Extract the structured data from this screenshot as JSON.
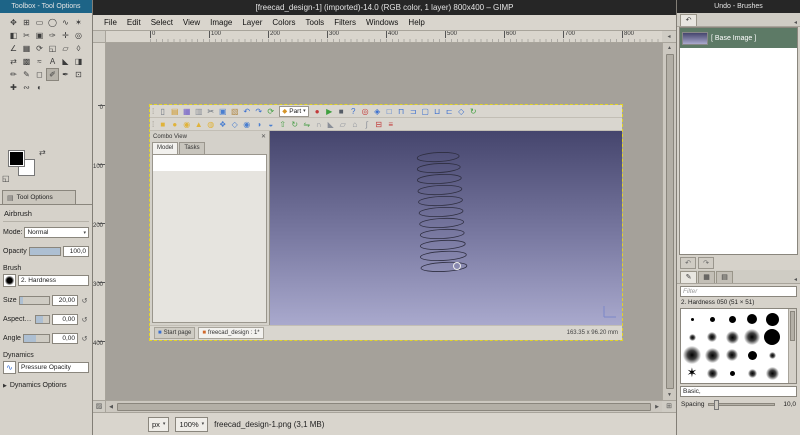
{
  "windows": {
    "toolbox_title": "Toolbox - Tool Options",
    "main_title": "[freecad_design-1] (imported)-14.0 (RGB color, 1 layer) 800x400 – GIMP",
    "dock_title": "Undo - Brushes"
  },
  "menubar": [
    "File",
    "Edit",
    "Select",
    "View",
    "Image",
    "Layer",
    "Colors",
    "Tools",
    "Filters",
    "Windows",
    "Help"
  ],
  "rulers": {
    "horizontal": [
      "0",
      "100",
      "200",
      "300",
      "400",
      "500",
      "600",
      "700",
      "800"
    ],
    "vertical": [
      "0",
      "100",
      "200",
      "300",
      "400"
    ]
  },
  "colors": {
    "focused_titlebar": "#1d6487",
    "titlebar": "#262626",
    "undo_selection": "#5d7a66",
    "viewport_gradient_top": "#45456d",
    "viewport_gradient_bottom": "#a9a9cd",
    "layer_boundary": "#e3d424"
  },
  "toolbox": {
    "tab_label": "Tool Options",
    "foreground_color": "#000000",
    "background_color": "#ffffff",
    "tools": [
      {
        "name": "move-tool",
        "glyph": "✥"
      },
      {
        "name": "alignment-tool",
        "glyph": "⊞"
      },
      {
        "name": "rectangle-select-tool",
        "glyph": "▭"
      },
      {
        "name": "ellipse-select-tool",
        "glyph": "◯"
      },
      {
        "name": "free-select-tool",
        "glyph": "∿"
      },
      {
        "name": "fuzzy-select-tool",
        "glyph": "✶"
      },
      {
        "name": "select-by-color-tool",
        "glyph": "◧"
      },
      {
        "name": "scissors-select-tool",
        "glyph": "✂"
      },
      {
        "name": "foreground-select-tool",
        "glyph": "▣"
      },
      {
        "name": "paths-tool",
        "glyph": "✑"
      },
      {
        "name": "color-picker-tool",
        "glyph": "✛"
      },
      {
        "name": "zoom-tool",
        "glyph": "◎"
      },
      {
        "name": "measure-tool",
        "glyph": "∠"
      },
      {
        "name": "crop-tool",
        "glyph": "▦"
      },
      {
        "name": "rotate-tool",
        "glyph": "⟳"
      },
      {
        "name": "scale-tool",
        "glyph": "◱"
      },
      {
        "name": "shear-tool",
        "glyph": "▱"
      },
      {
        "name": "perspective-tool",
        "glyph": "◊"
      },
      {
        "name": "flip-tool",
        "glyph": "⇄"
      },
      {
        "name": "cage-transform-tool",
        "glyph": "▩"
      },
      {
        "name": "warp-transform-tool",
        "glyph": "≈"
      },
      {
        "name": "text-tool",
        "glyph": "A"
      },
      {
        "name": "bucket-fill-tool",
        "glyph": "◣"
      },
      {
        "name": "gradient-tool",
        "glyph": "◨"
      },
      {
        "name": "pencil-tool",
        "glyph": "✏"
      },
      {
        "name": "paintbrush-tool",
        "glyph": "✎"
      },
      {
        "name": "eraser-tool",
        "glyph": "◻"
      },
      {
        "name": "airbrush-tool",
        "glyph": "✐",
        "state": "selected"
      },
      {
        "name": "ink-tool",
        "glyph": "✒"
      },
      {
        "name": "clone-tool",
        "glyph": "⊡"
      },
      {
        "name": "heal-tool",
        "glyph": "✚"
      },
      {
        "name": "smudge-tool",
        "glyph": "∾"
      },
      {
        "name": "dodge-burn-tool",
        "glyph": "◐"
      }
    ]
  },
  "tool_options": {
    "tool_name": "Airbrush",
    "mode_label": "Mode:",
    "mode_value": "Normal",
    "opacity_label": "Opacity",
    "opacity_value": "100,0",
    "brush_label": "Brush",
    "brush_name": "2. Hardness",
    "size_label": "Size",
    "size_value": "20,00",
    "aspect_label": "Aspect Ratio",
    "aspect_value": "0,00",
    "angle_label": "Angle",
    "angle_value": "0,00",
    "dynamics_label": "Dynamics",
    "dynamics_value": "Pressure Opacity",
    "dynamics_options_label": "Dynamics Options"
  },
  "statusbar": {
    "unit": "px",
    "zoom": "100%",
    "message": "freecad_design-1.png (3,1 MB)"
  },
  "freecad": {
    "workbench_label": "Part",
    "toolbar1a": [
      {
        "name": "file-new-icon",
        "glyph": "▯",
        "color": "#6a737f"
      },
      {
        "name": "file-open-icon",
        "glyph": "▤",
        "color": "#cf9a2f"
      },
      {
        "name": "file-save-icon",
        "glyph": "▦",
        "color": "#6f5bc9"
      },
      {
        "name": "print-icon",
        "glyph": "▥",
        "color": "#8a8f98"
      },
      {
        "name": "cut-icon",
        "glyph": "✂",
        "color": "#5a6472"
      },
      {
        "name": "copy-icon",
        "glyph": "▣",
        "color": "#4a7fd0"
      },
      {
        "name": "paste-icon",
        "glyph": "▧",
        "color": "#b08a4a"
      },
      {
        "name": "undo-icon",
        "glyph": "↶",
        "color": "#3a6fd0"
      },
      {
        "name": "redo-icon",
        "glyph": "↷",
        "color": "#3a6fd0"
      },
      {
        "name": "refresh-icon",
        "glyph": "⟳",
        "color": "#3f9f3f"
      }
    ],
    "toolbar1b": [
      {
        "name": "macro-record-icon",
        "glyph": "●",
        "color": "#c23a3a"
      },
      {
        "name": "macro-execute-icon",
        "glyph": "▶",
        "color": "#3f9f3f"
      },
      {
        "name": "macro-stop-icon",
        "glyph": "■",
        "color": "#555c66"
      },
      {
        "name": "whats-this-icon",
        "glyph": "?",
        "color": "#3a6fd0"
      },
      {
        "name": "view-fit-all-icon",
        "glyph": "◎",
        "color": "#c23a3a"
      },
      {
        "name": "view-isometric-icon",
        "glyph": "◈",
        "color": "#3a6fd0"
      },
      {
        "name": "view-front-icon",
        "glyph": "□",
        "color": "#3a6fd0"
      },
      {
        "name": "view-top-icon",
        "glyph": "⊓",
        "color": "#3a6fd0"
      },
      {
        "name": "view-right-icon",
        "glyph": "⊐",
        "color": "#3a6fd0"
      },
      {
        "name": "view-rear-icon",
        "glyph": "▢",
        "color": "#3a6fd0"
      },
      {
        "name": "view-bottom-icon",
        "glyph": "⊔",
        "color": "#3a6fd0"
      },
      {
        "name": "view-left-icon",
        "glyph": "⊏",
        "color": "#3a6fd0"
      },
      {
        "name": "view-axonometric-icon",
        "glyph": "◇",
        "color": "#3a6fd0"
      },
      {
        "name": "refresh-view-icon",
        "glyph": "↻",
        "color": "#3f9f3f"
      }
    ],
    "toolbar2": [
      {
        "name": "part-box-icon",
        "glyph": "■",
        "color": "#e0b33a"
      },
      {
        "name": "part-cylinder-icon",
        "glyph": "●",
        "color": "#e0b33a"
      },
      {
        "name": "part-sphere-icon",
        "glyph": "◉",
        "color": "#e0b33a"
      },
      {
        "name": "part-cone-icon",
        "glyph": "▲",
        "color": "#e0b33a"
      },
      {
        "name": "part-torus-icon",
        "glyph": "◍",
        "color": "#e0b33a"
      },
      {
        "name": "part-primitives-icon",
        "glyph": "❖",
        "color": "#4a7fd0"
      },
      {
        "name": "shape-builder-icon",
        "glyph": "◇",
        "color": "#4a7fd0"
      },
      {
        "name": "boolean-union-icon",
        "glyph": "◉",
        "color": "#4a7fd0"
      },
      {
        "name": "boolean-cut-icon",
        "glyph": "◑",
        "color": "#4a7fd0"
      },
      {
        "name": "boolean-intersection-icon",
        "glyph": "◒",
        "color": "#4a7fd0"
      },
      {
        "name": "extrude-icon",
        "glyph": "⇧",
        "color": "#4a9f4a"
      },
      {
        "name": "revolve-icon",
        "glyph": "↻",
        "color": "#4a9f4a"
      },
      {
        "name": "mirror-icon",
        "glyph": "⇋",
        "color": "#4a9f4a"
      },
      {
        "name": "fillet-icon",
        "glyph": "∩",
        "color": "#8a8f98"
      },
      {
        "name": "chamfer-icon",
        "glyph": "◣",
        "color": "#8a8f98"
      },
      {
        "name": "ruled-surface-icon",
        "glyph": "▱",
        "color": "#8a8f98"
      },
      {
        "name": "loft-icon",
        "glyph": "⌂",
        "color": "#8a8f98"
      },
      {
        "name": "sweep-icon",
        "glyph": "∫",
        "color": "#8a8f98"
      },
      {
        "name": "section-icon",
        "glyph": "⊟",
        "color": "#c23a3a"
      },
      {
        "name": "cross-sections-icon",
        "glyph": "≡",
        "color": "#c23a3a"
      }
    ],
    "combo_view": {
      "title": "Combo View",
      "tabs": [
        "Model",
        "Tasks"
      ]
    },
    "doc_tabs": [
      {
        "label": "Start page"
      },
      {
        "label": "freecad_design : 1*"
      }
    ],
    "status_dimensions": "163.35 x 96.20 mm"
  },
  "right_dock": {
    "undo": {
      "items": [
        {
          "label": "[ Base Image ]",
          "selected": true
        }
      ]
    },
    "brushes": {
      "filter_placeholder": "Filter",
      "selected_brush": "2. Hardness 050 (51 × 51)",
      "tags_value": "Basic,",
      "spacing_label": "Spacing",
      "spacing_value": "10,0",
      "grid": [
        {
          "type": "dot",
          "size": 3
        },
        {
          "type": "dot",
          "size": 5
        },
        {
          "type": "dot",
          "size": 7
        },
        {
          "type": "dot",
          "size": 10
        },
        {
          "type": "dot",
          "size": 13
        },
        {
          "type": "soft",
          "size": 7
        },
        {
          "type": "soft",
          "size": 10
        },
        {
          "type": "soft",
          "size": 13
        },
        {
          "type": "soft",
          "size": 16
        },
        {
          "type": "dot",
          "size": 16
        },
        {
          "type": "soft",
          "size": 18
        },
        {
          "type": "soft",
          "size": 15
        },
        {
          "type": "soft",
          "size": 12
        },
        {
          "type": "dot",
          "size": 9
        },
        {
          "type": "soft",
          "size": 7
        },
        {
          "type": "star",
          "size": 13
        },
        {
          "type": "soft",
          "size": 11
        },
        {
          "type": "dot",
          "size": 5
        },
        {
          "type": "soft",
          "size": 9
        },
        {
          "type": "soft",
          "size": 13
        }
      ]
    }
  }
}
